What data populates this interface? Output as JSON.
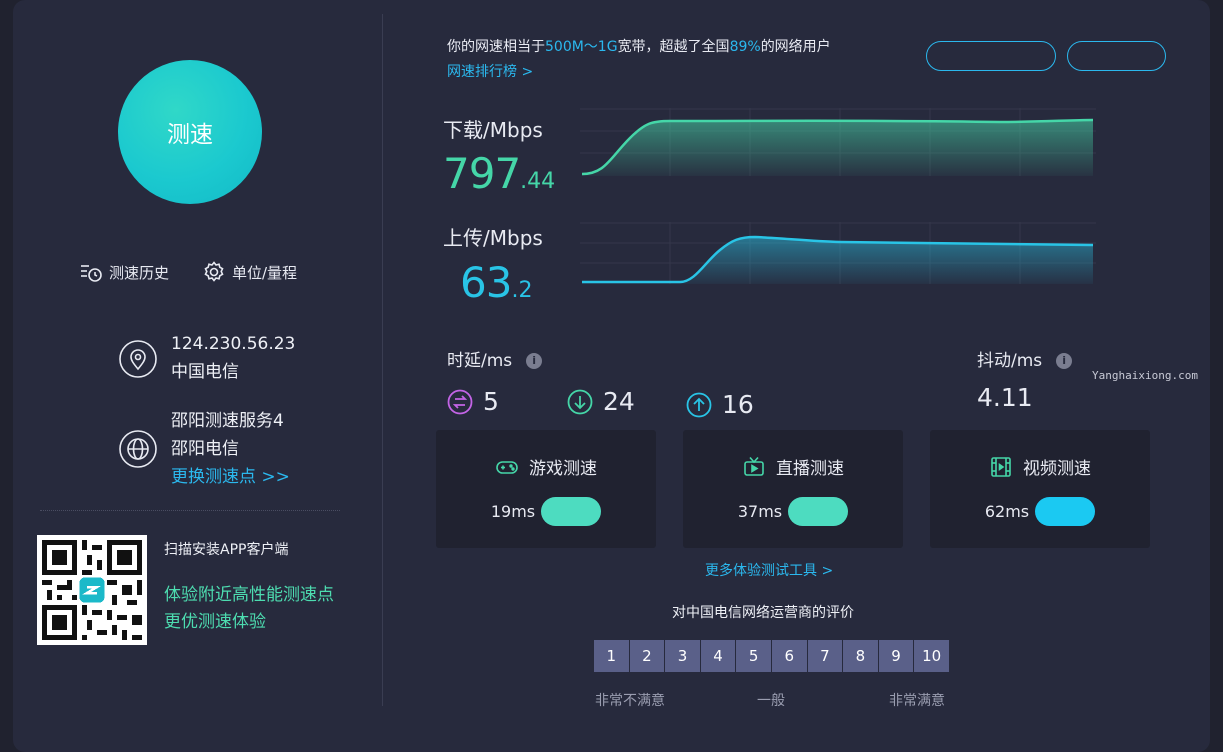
{
  "left": {
    "start_button": "测速",
    "history_label": "测速历史",
    "units_label": "单位/量程",
    "ip_address": "124.230.56.23",
    "isp": "中国电信",
    "server_name": "邵阳测速服务4",
    "server_isp": "邵阳电信",
    "change_server": "更换测速点 >>",
    "qr_title": "扫描安装APP客户端",
    "qr_line1": "体验附近高性能测速点",
    "qr_line2": "更优测速体验"
  },
  "summary": {
    "prefix": "你的网速相当于",
    "bandwidth": "500M～1G",
    "middle": "宽带，超越了全国",
    "percent": "89%",
    "suffix": "的网络用户",
    "rank_link": "网速排行榜 >"
  },
  "download": {
    "label": "下载/Mbps",
    "int": "797",
    "dec": ".44",
    "color": "#45d6a8"
  },
  "upload": {
    "label": "上传/Mbps",
    "int": "63",
    "dec": ".2",
    "color": "#29c4e6"
  },
  "latency": {
    "label": "时延/ms",
    "idle": "5",
    "down": "24",
    "up": "16"
  },
  "jitter": {
    "label": "抖动/ms",
    "value": "4.11"
  },
  "cards": [
    {
      "title": "游戏测速",
      "value": "19ms",
      "color": "#4ddcc0"
    },
    {
      "title": "直播测速",
      "value": "37ms",
      "color": "#4ddcc0"
    },
    {
      "title": "视频测速",
      "value": "62ms",
      "color": "#1bc9f2"
    }
  ],
  "more_tools": "更多体验测试工具 >",
  "rating": {
    "title": "对中国电信网络运营商的评价",
    "scores": [
      "1",
      "2",
      "3",
      "4",
      "5",
      "6",
      "7",
      "8",
      "9",
      "10"
    ],
    "low": "非常不满意",
    "mid": "一般",
    "high": "非常满意"
  },
  "watermark": "Yanghaixiong.com"
}
